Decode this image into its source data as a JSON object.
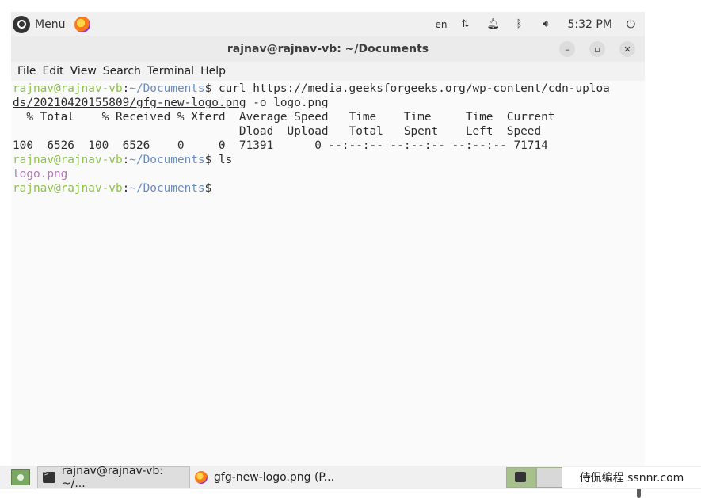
{
  "panel": {
    "menu_label": "Menu",
    "lang": "en",
    "clock": "5:32 PM",
    "icons": [
      "network-icon",
      "notification-icon",
      "bluetooth-icon",
      "volume-icon",
      "power-icon"
    ]
  },
  "window": {
    "title": "rajnav@rajnav-vb: ~/Documents",
    "menus": [
      "File",
      "Edit",
      "View",
      "Search",
      "Terminal",
      "Help"
    ]
  },
  "terminal": {
    "prompt_user": "rajnav@rajnav-vb",
    "prompt_sep": ":",
    "prompt_path": "~/Documents",
    "prompt_end": "$",
    "cmd1": " curl ",
    "url_part1": "https://media.geeksforgeeks.org/wp-content/cdn-uploa",
    "url_part2": "ds/20210420155809/gfg-new-logo.png",
    "cmd1_tail": " -o logo.png",
    "header1": "  % Total    % Received % Xferd  Average Speed   Time    Time     Time  Current",
    "header2": "                                 Dload  Upload   Total   Spent    Left  Speed",
    "progress": "100  6526  100  6526    0     0  71391      0 --:--:-- --:--:-- --:--:-- 71714",
    "cmd2": " ls",
    "file1": "logo.png"
  },
  "taskbar": {
    "task1_label": "rajnav@rajnav-vb: ~/...",
    "task2_label": "gfg-new-logo.png (P..."
  },
  "watermark": "侍侃编程 ssnnr.com"
}
